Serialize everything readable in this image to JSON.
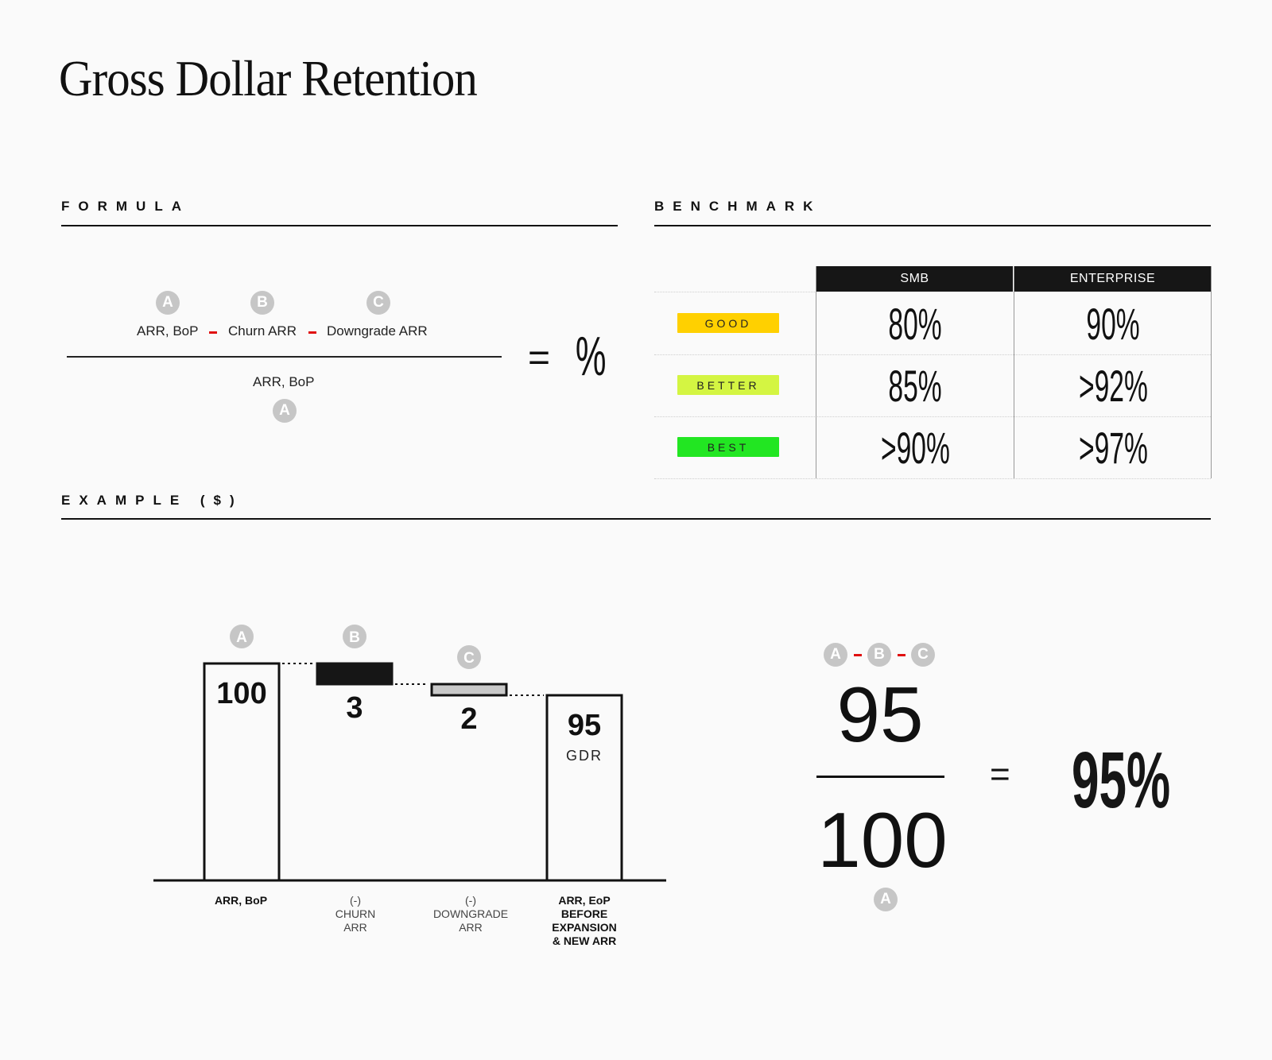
{
  "title": "Gross Dollar Retention",
  "sections": {
    "formula": "FORMULA",
    "benchmark": "BENCHMARK",
    "example": "EXAMPLE ($)"
  },
  "formula": {
    "numerator_terms": [
      {
        "badge": "A",
        "label": "ARR, BoP"
      },
      {
        "badge": "B",
        "label": "Churn ARR"
      },
      {
        "badge": "C",
        "label": "Downgrade ARR"
      }
    ],
    "operator": "-",
    "denominator": {
      "badge": "A",
      "label": "ARR, BoP"
    },
    "equals": "=",
    "result": "%"
  },
  "benchmark": {
    "columns": [
      "SMB",
      "ENTERPRISE"
    ],
    "rows": [
      {
        "tier": "GOOD",
        "color": "#ffd000",
        "smb": "80%",
        "enterprise": "90%"
      },
      {
        "tier": "BETTER",
        "color": "#d4f542",
        "smb": "85%",
        "enterprise": ">92%"
      },
      {
        "tier": "BEST",
        "color": "#22e622",
        "smb": ">90%",
        "enterprise": ">97%"
      }
    ]
  },
  "chart_data": {
    "type": "waterfall",
    "title": "EXAMPLE ($)",
    "categories": [
      "ARR, BoP",
      "(-) CHURN ARR",
      "(-) DOWNGRADE ARR",
      "ARR, EoP BEFORE EXPANSION & NEW ARR"
    ],
    "values": [
      100,
      -3,
      -2,
      95
    ],
    "labels": [
      "100",
      "3",
      "2",
      "95"
    ],
    "badges": [
      "A",
      "B",
      "C",
      ""
    ],
    "end_sublabel": "GDR",
    "bar_styles": [
      "outline",
      "filled-black",
      "filled-gray",
      "outline"
    ],
    "ylim": [
      0,
      100
    ]
  },
  "example_equation": {
    "numerator_badges": [
      "A",
      "B",
      "C"
    ],
    "numerator": "95",
    "denominator": "100",
    "denominator_badge": "A",
    "equals": "=",
    "result": "95%"
  },
  "colors": {
    "badge_gray": "#c6c6c6",
    "minus_red": "#e01010",
    "header_black": "#161616",
    "downgrade_gray": "#c8c8c8"
  }
}
